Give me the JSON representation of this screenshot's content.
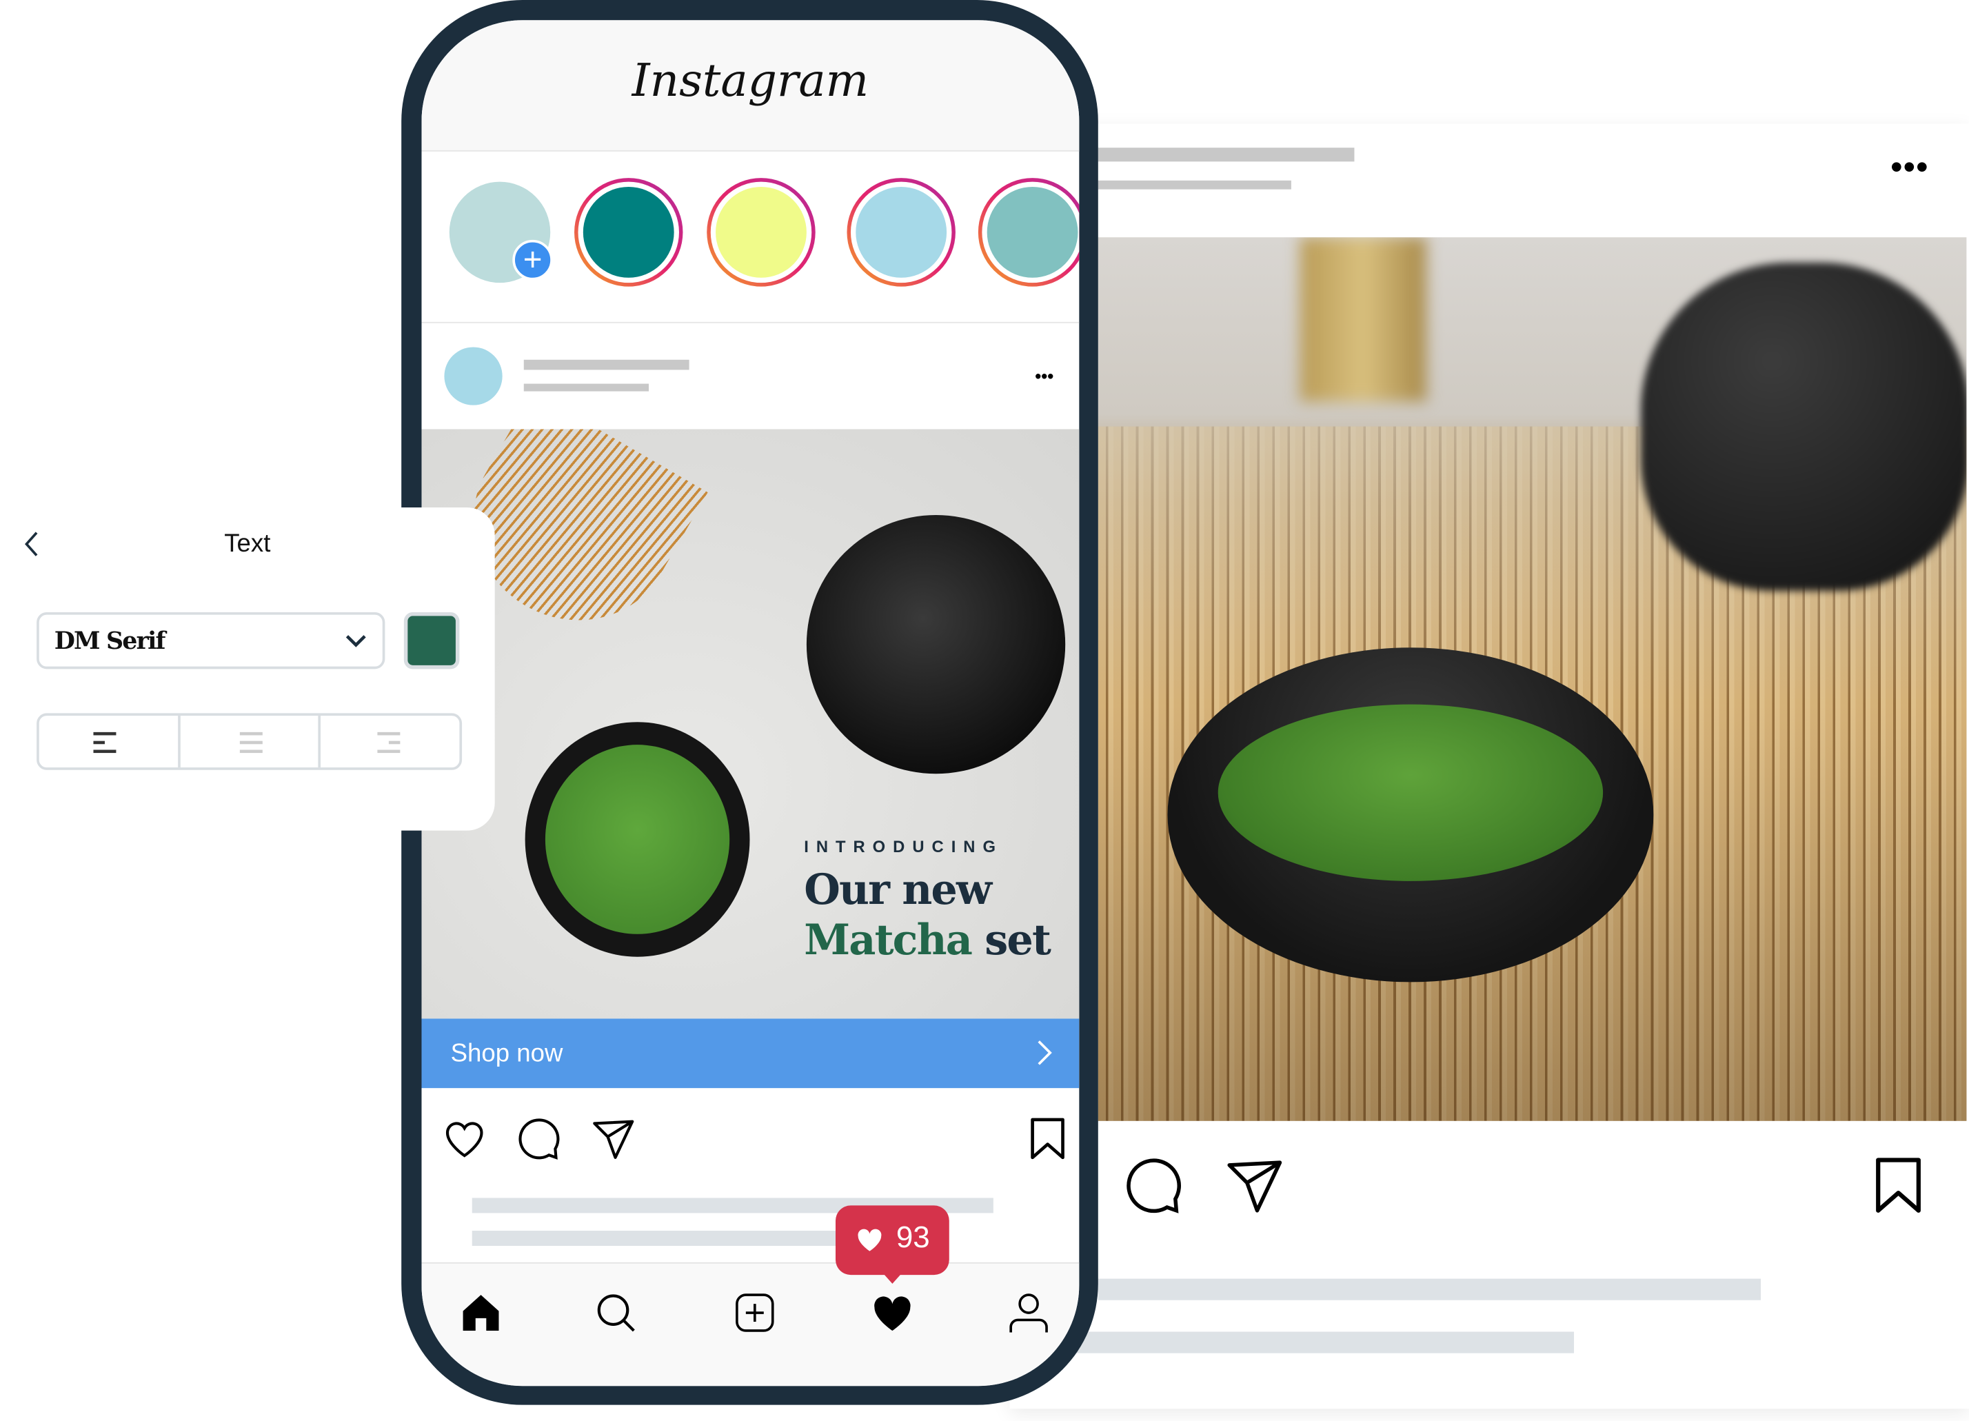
{
  "phone": {
    "app_title": "Instagram",
    "stories": [
      {
        "color": "#bcdcdc",
        "own": true,
        "add_icon": "plus-icon"
      },
      {
        "color": "#00807f"
      },
      {
        "color": "#f0fb8a"
      },
      {
        "color": "#a6d9e8"
      },
      {
        "color": "#81c1c0"
      }
    ],
    "post": {
      "avatar_color": "#a6d9e8",
      "more_icon": "more-horizontal-icon",
      "overline": "INTRODUCING",
      "headline_line1": "Our new",
      "headline_line2_green": "Matcha",
      "headline_line2_rest": " set",
      "cta_label": "Shop now",
      "cta_color": "#5399e8",
      "actions": [
        "heart-icon",
        "comment-icon",
        "send-icon",
        "bookmark-icon"
      ]
    },
    "like_badge": {
      "count": "93",
      "color": "#d5334b"
    },
    "tab_bar": [
      "home-icon",
      "search-icon",
      "add-post-icon",
      "activity-heart-icon",
      "profile-icon"
    ]
  },
  "desktop_post": {
    "more_icon": "more-horizontal-icon",
    "actions": [
      "comment-icon",
      "send-icon",
      "bookmark-icon"
    ]
  },
  "text_panel": {
    "title": "Text",
    "font_select": {
      "value": "DM Serif"
    },
    "color_swatch": "#256650",
    "alignment": [
      "align-left",
      "align-center",
      "align-right"
    ],
    "selected_alignment": "align-left"
  },
  "colors": {
    "phone_frame": "#1c2e3d",
    "headline": "#1c2e3d",
    "accent_green": "#22664a"
  }
}
